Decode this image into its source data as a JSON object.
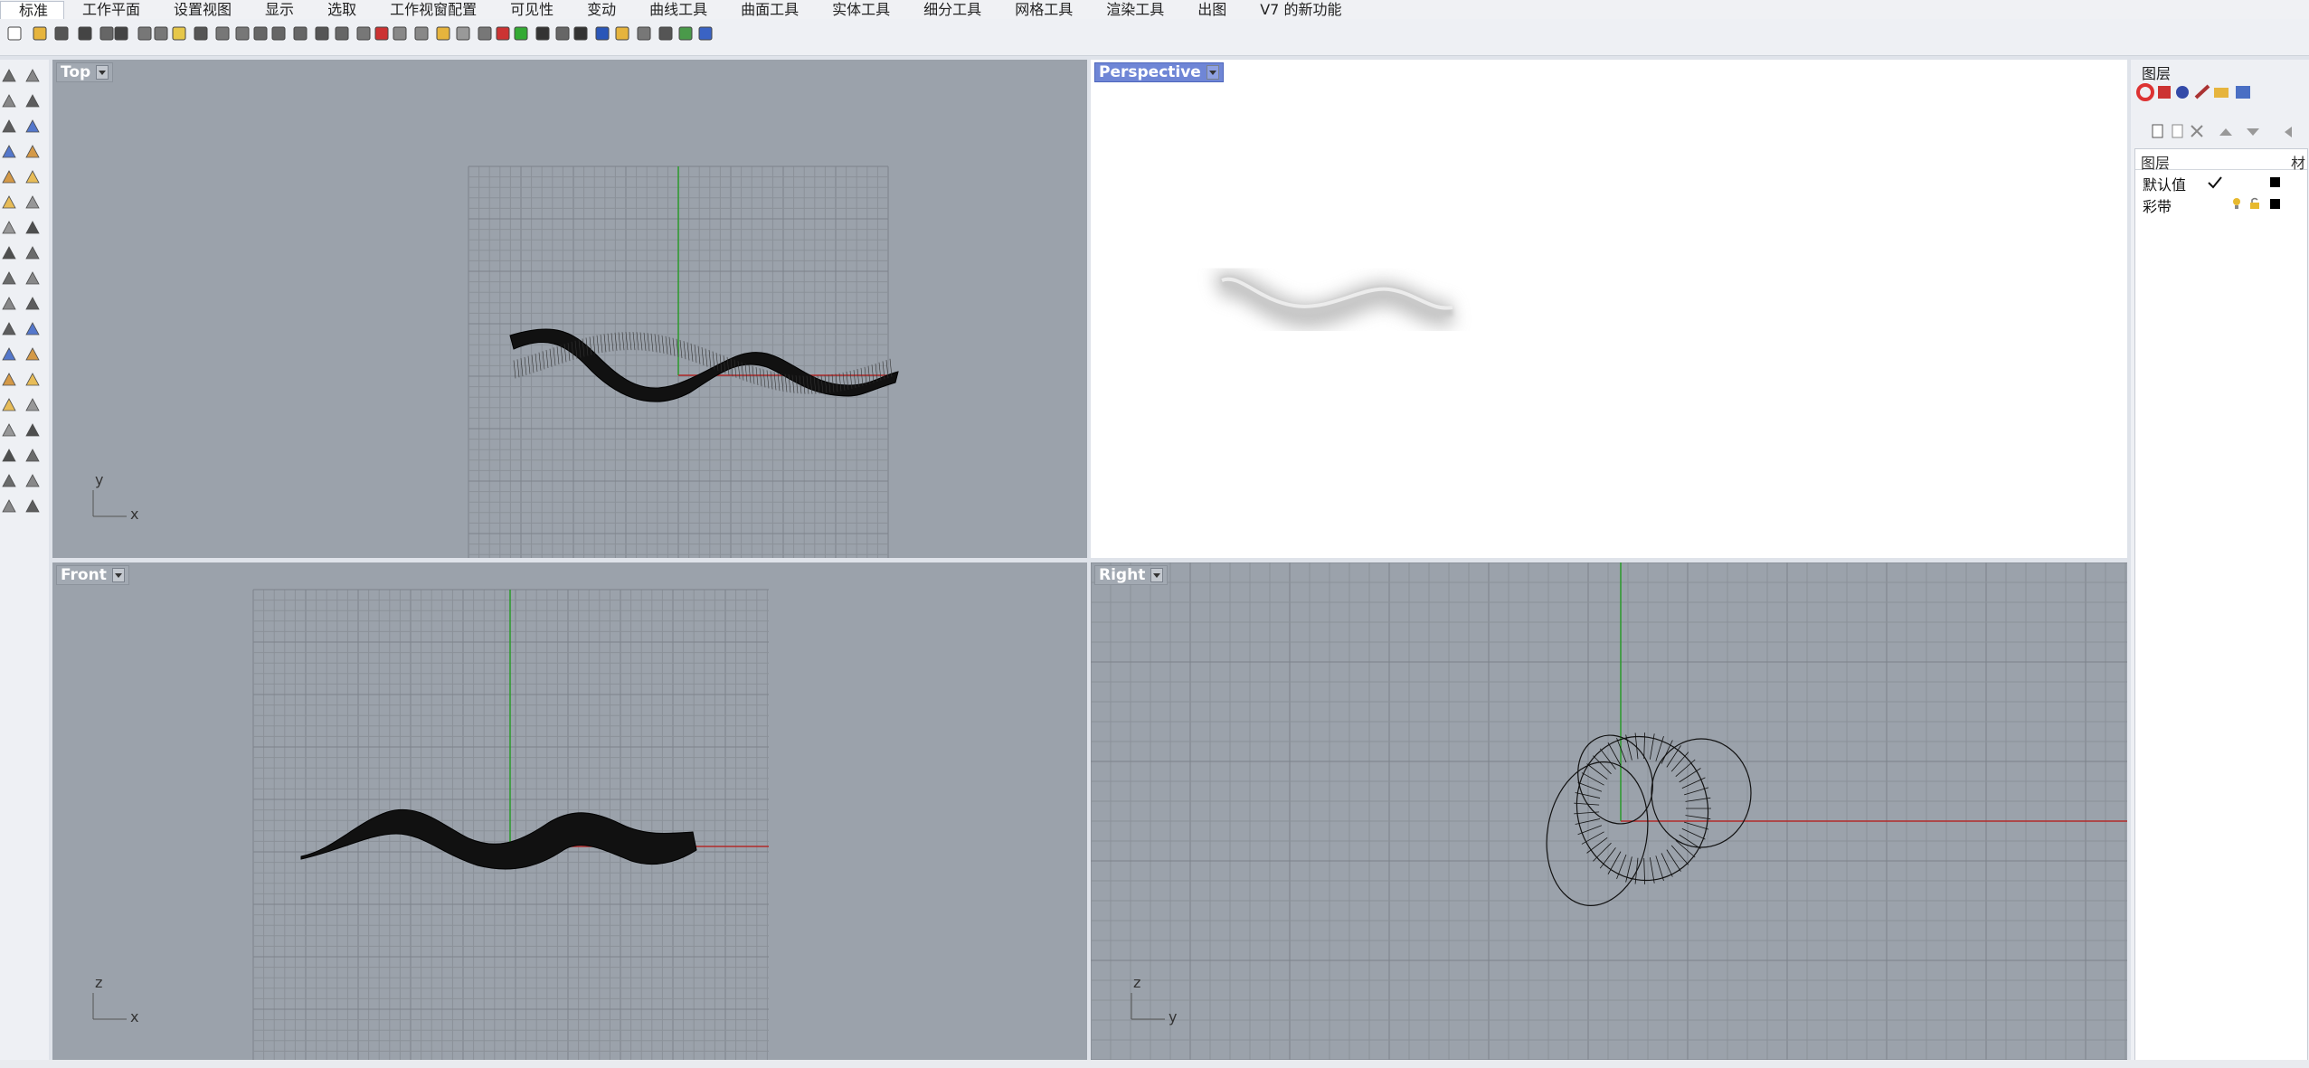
{
  "menu": {
    "tabs": [
      "标准",
      "工作平面",
      "设置视图",
      "显示",
      "选取",
      "工作视窗配置",
      "可见性",
      "变动",
      "曲线工具",
      "曲面工具",
      "实体工具",
      "细分工具",
      "网格工具",
      "渲染工具",
      "出图",
      "V7 的新功能"
    ]
  },
  "viewports": {
    "top": {
      "label": "Top",
      "axis_a": "y",
      "axis_b": "x"
    },
    "perspective": {
      "label": "Perspective"
    },
    "front": {
      "label": "Front",
      "axis_a": "z",
      "axis_b": "x"
    },
    "right": {
      "label": "Right",
      "axis_a": "z",
      "axis_b": "y"
    }
  },
  "layers_panel": {
    "title": "图层",
    "col_layer": "图层",
    "col_material": "材",
    "layers": [
      {
        "name": "默认值",
        "current": true,
        "color": "#000000"
      },
      {
        "name": "彩带",
        "current": false,
        "color": "#000000"
      }
    ]
  },
  "colors": {
    "viewport_bg": "#9ba2ab",
    "grid_minor": "#8b9199",
    "grid_major": "#7d838b",
    "x_axis": "#b22a2a",
    "y_axis": "#2b9a2b",
    "active_label": "#6f86d6"
  }
}
